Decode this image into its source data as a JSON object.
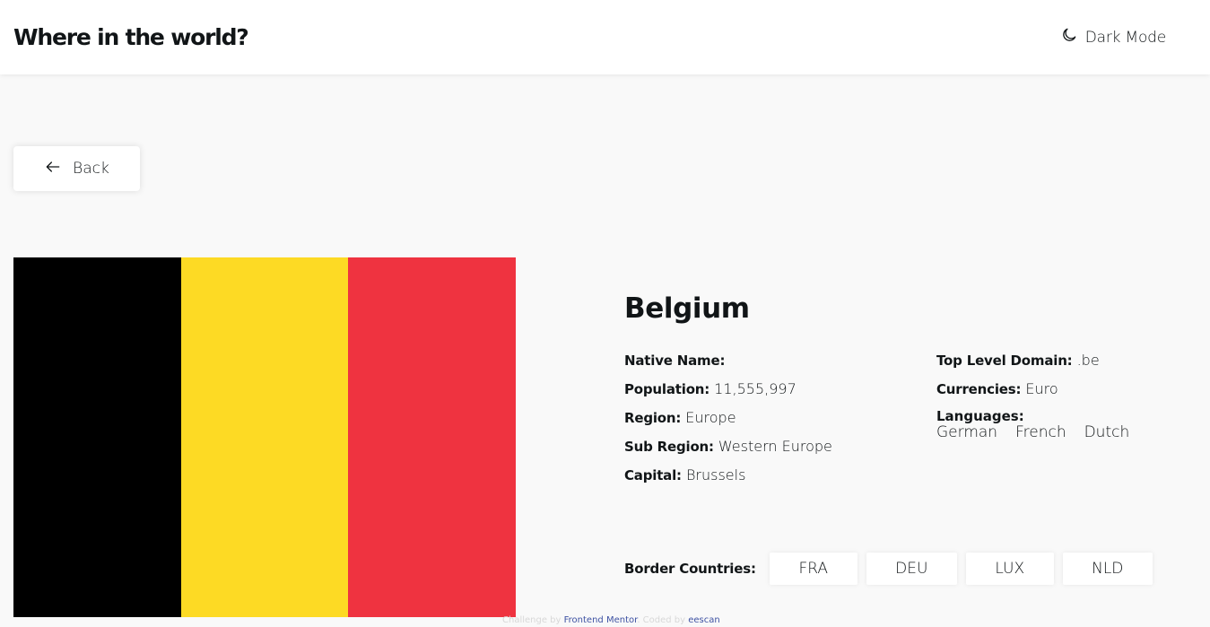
{
  "header": {
    "title": "Where in the world?",
    "dark_mode_label": "Dark Mode",
    "dark_mode_icon": "moon-icon"
  },
  "back_button": {
    "label": "Back",
    "icon": "arrow-left-icon"
  },
  "country": {
    "name": "Belgium",
    "flag_colors": [
      "#000000",
      "#FDDA24",
      "#EF3340"
    ],
    "native_name": {
      "label": "Native Name:",
      "value": ""
    },
    "population": {
      "label": "Population:",
      "value": "11,555,997"
    },
    "region": {
      "label": "Region:",
      "value": "Europe"
    },
    "sub_region": {
      "label": "Sub Region:",
      "value": "Western Europe"
    },
    "capital": {
      "label": "Capital:",
      "value": "Brussels"
    },
    "top_level_domain": {
      "label": "Top Level Domain:",
      "value": ".be"
    },
    "currencies": {
      "label": "Currencies:",
      "value": "Euro"
    },
    "languages": {
      "label": "Languages:",
      "values": [
        "German",
        "French",
        "Dutch"
      ]
    },
    "border_countries": {
      "label": "Border Countries:",
      "values": [
        "FRA",
        "DEU",
        "LUX",
        "NLD"
      ]
    }
  },
  "attribution": {
    "prefix": "Challenge by",
    "link1": "Frontend Mentor",
    "middle": ". Coded by",
    "link2": "eescan"
  }
}
